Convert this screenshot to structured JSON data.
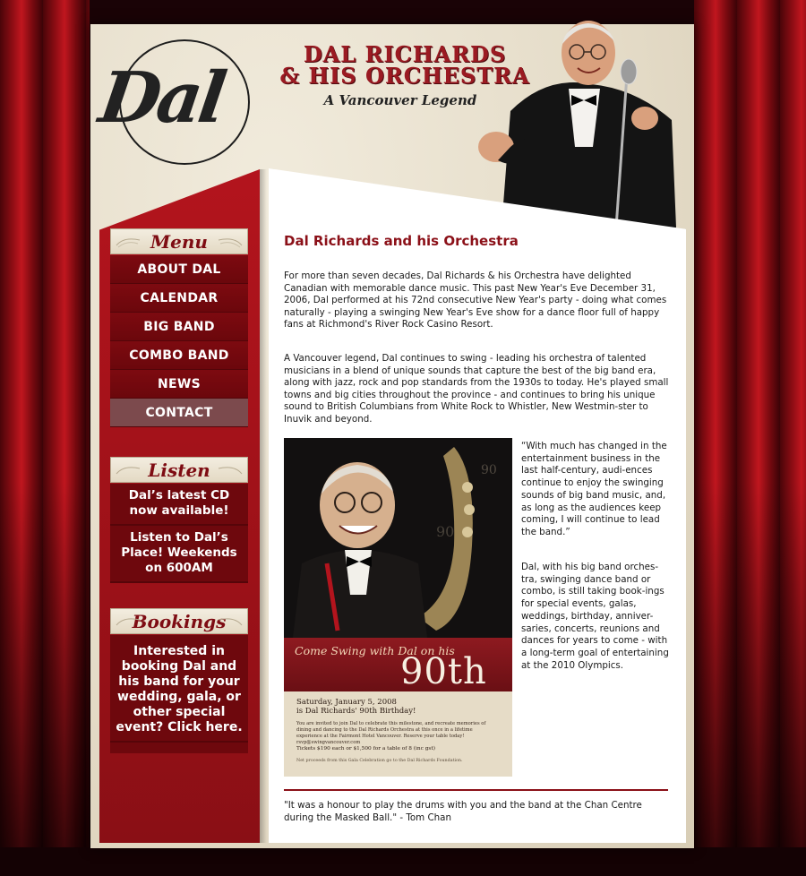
{
  "header": {
    "logo_text": "Dal",
    "title_line1": "DAL RICHARDS",
    "title_line2": "& HIS ORCHESTRA",
    "subtitle": "A Vancouver Legend"
  },
  "sidebar": {
    "menu_heading": "Menu",
    "menu_items": [
      {
        "label": "ABOUT DAL"
      },
      {
        "label": "CALENDAR"
      },
      {
        "label": "BIG BAND"
      },
      {
        "label": "COMBO BAND"
      },
      {
        "label": "NEWS"
      },
      {
        "label": "CONTACT",
        "active": true
      }
    ],
    "listen_heading": "Listen",
    "listen_items": [
      {
        "label": "Dal’s latest CD now available!"
      },
      {
        "label": "Listen to Dal’s Place! Weekends on 600AM"
      }
    ],
    "bookings_heading": "Bookings",
    "bookings_text": "Interested in booking Dal and his band for your wedding, gala, or other special event? Click here."
  },
  "main": {
    "heading": "Dal Richards and his Orchestra",
    "paragraph1": "For more than seven decades, Dal Richards & his Orchestra have delighted Canadian with memorable dance music. This past New Year's Eve December 31, 2006, Dal performed at his 72nd consecutive New Year's party - doing what comes naturally - playing a swinging New Year's Eve show for a dance floor full of happy fans at Richmond's River Rock Casino Resort.",
    "paragraph2": "A Vancouver legend, Dal continues to swing - leading his orchestra of talented musicians in a blend of unique sounds that capture the best of the big band era, along with jazz, rock and pop standards from the 1930s to today. He's played small towns and big cities throughout the province - and continues to bring his unique sound to British Columbians from White Rock to Whistler, New Westmin-ster to Inuvik and beyond.",
    "quote": "“With much has changed in the entertainment business in the last half-century, audi-ences continue to enjoy the swinging sounds of big band music, and, as long as the audiences keep coming, I will continue to lead the band.”",
    "paragraph3": "Dal, with his big band orches-tra, swinging dance band or combo, is still taking book-ings for special events, galas, weddings, birthday, anniver-saries, concerts, reunions and dances for years to come - with a long-term goal of entertaining at the 2010 Olympics.",
    "testimonial": "\"It was a honour to play the drums with you and the band at the Chan Centre during the Masked Ball.\" - Tom Chan"
  },
  "poster": {
    "tagline": "Come Swing with Dal on his",
    "big_number": "90th",
    "date_line1": "Saturday, January 5, 2008",
    "date_line2": "is Dal Richards' 90th Birthday!",
    "fine_print": "You are invited to join Dal to celebrate this milestone, and recreate memories of dining and dancing to the Dal Richards Orchestra at this once in a lifetime experience at the Fairmont Hotel Vancouver. Reserve your table today! rsvp@swingvancouver.com",
    "tickets": "Tickets $190 each or $1,500 for a table of 8 (inc gst)",
    "proceeds": "Net proceeds from this Gala Celebration go to the Dal Richards Foundation."
  },
  "colors": {
    "brand_red": "#9b1a22",
    "menu_bg": "#7d0a10",
    "menu_active": "#7c4a4d",
    "heading_red": "#8b1018"
  }
}
